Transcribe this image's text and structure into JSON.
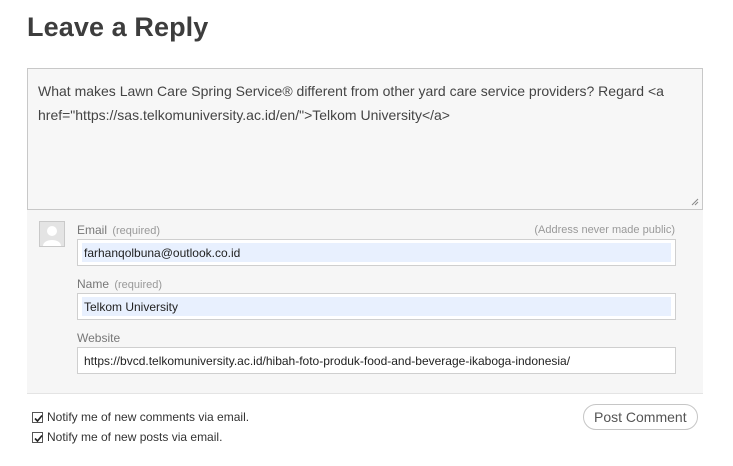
{
  "heading": "Leave a Reply",
  "comment": {
    "text": "What makes Lawn Care Spring Service® different from other yard care service providers? Regard <a href=\"https://sas.telkomuniversity.ac.id/en/\">Telkom University</a>"
  },
  "fields": {
    "email": {
      "label": "Email",
      "required": "(required)",
      "note": "(Address never made public)",
      "value": "farhanqolbuna@outlook.co.id"
    },
    "name": {
      "label": "Name",
      "required": "(required)",
      "value": "Telkom University"
    },
    "website": {
      "label": "Website",
      "value": "https://bvcd.telkomuniversity.ac.id/hibah-foto-produk-food-and-beverage-ikaboga-indonesia/"
    }
  },
  "options": {
    "notify_comments": {
      "label": "Notify me of new comments via email.",
      "checked": true
    },
    "notify_posts": {
      "label": "Notify me of new posts via email.",
      "checked": true
    }
  },
  "submit_label": "Post Comment",
  "colors": {
    "autofill": "#e8f0fe",
    "panel": "#f6f6f6"
  }
}
